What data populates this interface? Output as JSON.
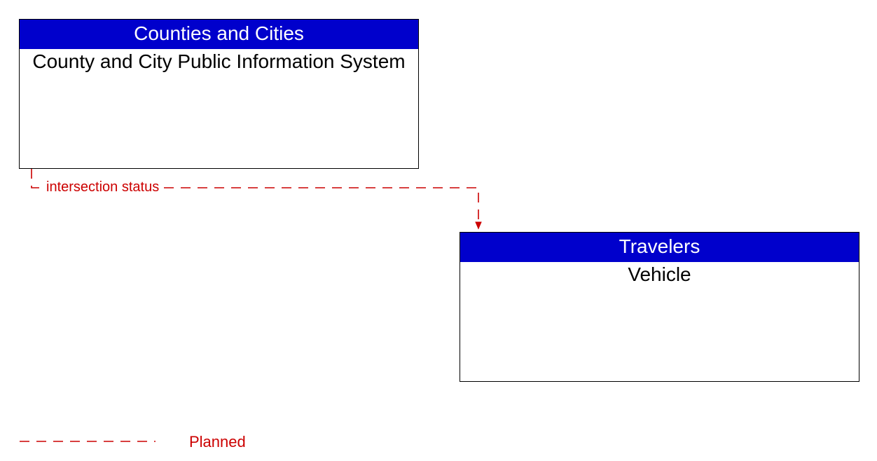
{
  "colors": {
    "header_bg": "#0000cc",
    "flow": "#cc0000"
  },
  "boxes": {
    "source": {
      "header": "Counties and Cities",
      "body": "County and City Public Information System"
    },
    "target": {
      "header": "Travelers",
      "body": "Vehicle"
    }
  },
  "flow": {
    "label": "intersection status"
  },
  "legend": {
    "planned": "Planned"
  }
}
